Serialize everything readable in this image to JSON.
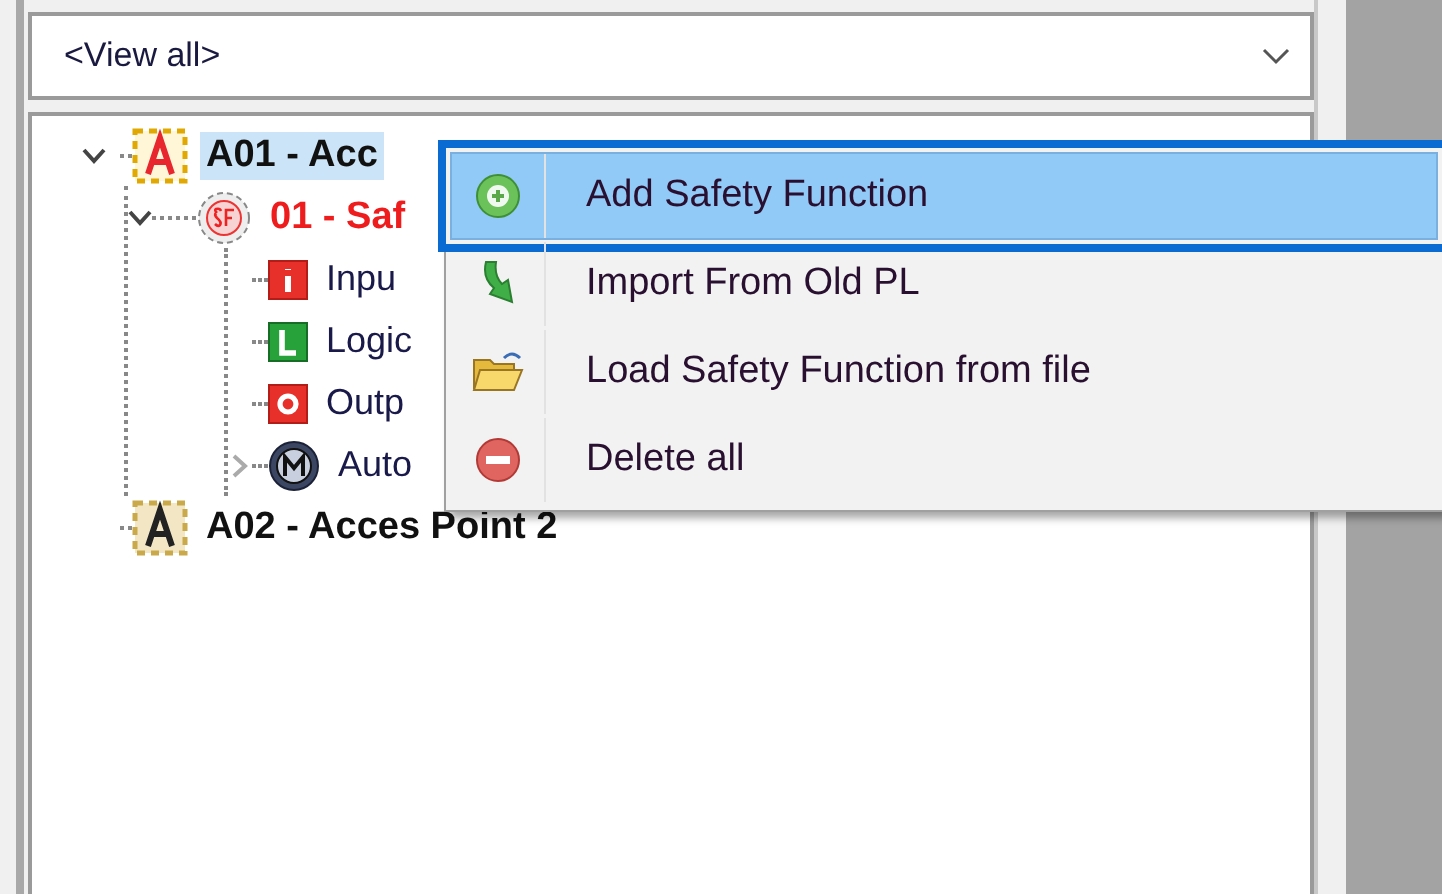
{
  "filter": {
    "value": "<View all>"
  },
  "tree": [
    {
      "label": "A01 - Acc",
      "kind": "access-point",
      "selected": true,
      "expanded": true,
      "children": [
        {
          "label": "01 - Saf",
          "kind": "safety-function",
          "selected": false,
          "expanded": true,
          "children": [
            {
              "label": "Inpu",
              "kind": "input",
              "selected": false
            },
            {
              "label": "Logic",
              "kind": "logic",
              "selected": false
            },
            {
              "label": "Outp",
              "kind": "output",
              "selected": false
            },
            {
              "label": "Auto",
              "kind": "motor",
              "selected": false,
              "expanded": false
            }
          ]
        }
      ]
    },
    {
      "label": "A02 - Acces Point 2",
      "kind": "access-point-inactive",
      "selected": false
    }
  ],
  "context_menu": [
    {
      "label": "Add Safety Function",
      "kind": "add",
      "selected": true
    },
    {
      "label": "Import From Old PL",
      "kind": "import",
      "selected": false
    },
    {
      "label": "Load Safety Function from file",
      "kind": "load",
      "selected": false
    },
    {
      "label": "Delete all",
      "kind": "delete",
      "selected": false
    }
  ]
}
